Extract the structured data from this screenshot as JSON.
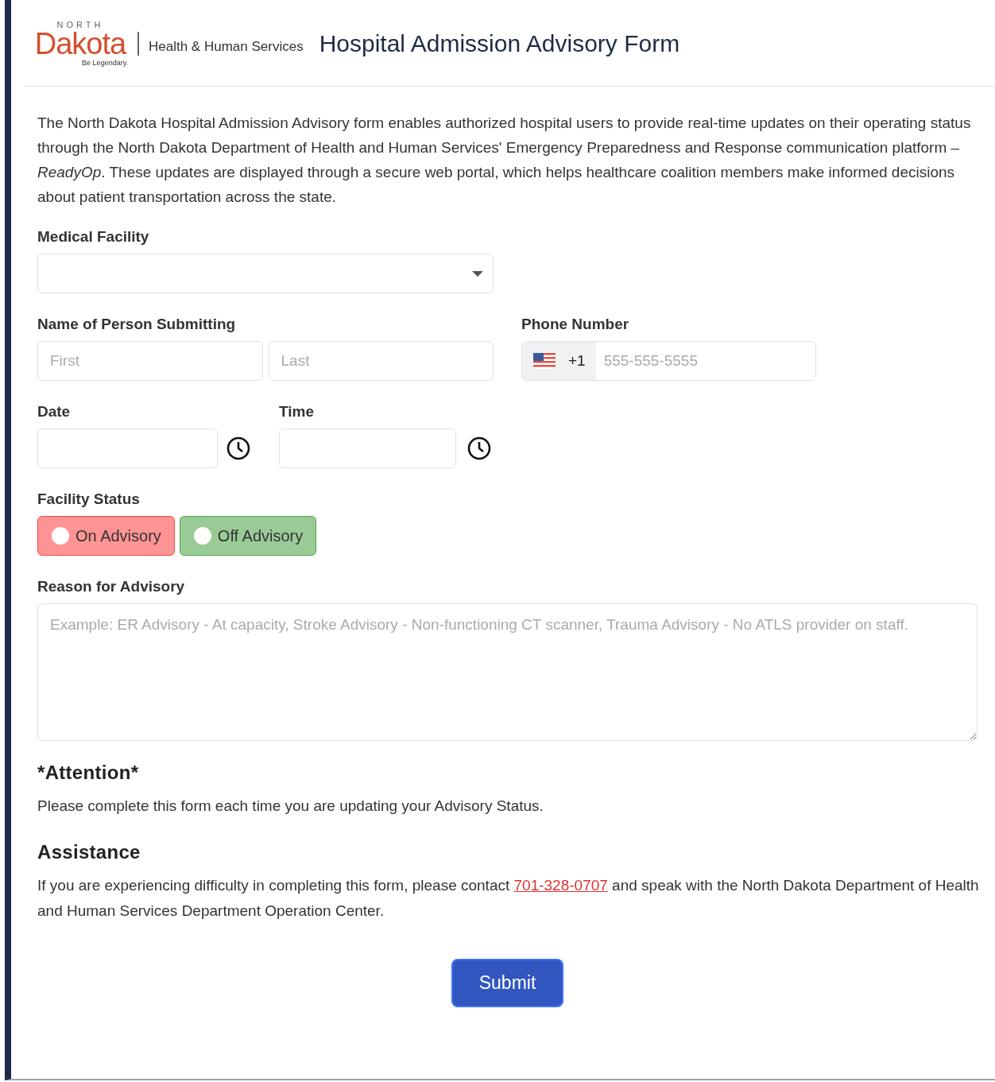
{
  "header": {
    "logo": {
      "top": "NORTH",
      "main": "Dakota",
      "tagline": "Be Legendary.",
      "agency": "Health & Human Services"
    },
    "title": "Hospital Admission Advisory Form"
  },
  "intro": "The North Dakota Hospital Admission Advisory form enables authorized hospital users to provide real-time updates on their operating status through the North Dakota Department of Health and Human Services' Emergency Preparedness and Response communication platform –*ReadyOp*. These updates are displayed through a secure web portal, which helps healthcare coalition members make informed decisions about patient transportation across the state.",
  "medical_facility": {
    "label": "Medical Facility"
  },
  "name": {
    "label": "Name of Person Submitting",
    "first": {
      "placeholder": "First"
    },
    "last": {
      "placeholder": "Last"
    }
  },
  "phone": {
    "label": "Phone Number",
    "code": "+1",
    "placeholder": "555-555-5555"
  },
  "date": {
    "label": "Date"
  },
  "time": {
    "label": "Time"
  },
  "facility_status": {
    "label": "Facility Status",
    "options": [
      {
        "label": "On Advisory",
        "kind": "on",
        "selected": false
      },
      {
        "label": "Off Advisory",
        "kind": "off",
        "selected": false
      }
    ]
  },
  "reason": {
    "label": "Reason for Advisory",
    "placeholder": "Example: ER Advisory - At capacity, Stroke Advisory - Non-functioning CT scanner, Trauma Advisory - No ATLS provider on staff."
  },
  "attention": {
    "heading": "*Attention*",
    "text": "Please complete this form each time you are updating your Advisory Status."
  },
  "assistance": {
    "heading": "Assistance",
    "text_before": "If you are experiencing difficulty in completing this form, please contact ",
    "link": "701-328-0707",
    "text_after": " and speak with the North Dakota Department of Health and Human Services Department Operation Center."
  },
  "submit": "Submit"
}
